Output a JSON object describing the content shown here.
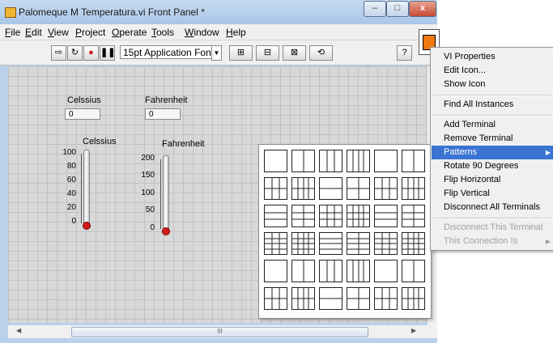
{
  "window": {
    "title": "Palomeque M Temperatura.vi Front Panel *",
    "minimize": "–",
    "maximize": "□",
    "close": "x"
  },
  "menubar": [
    "File",
    "Edit",
    "View",
    "Project",
    "Operate",
    "Tools",
    "Window",
    "Help"
  ],
  "toolbar": {
    "font": "15pt Application Font",
    "help": "?"
  },
  "panel": {
    "celsius_control": {
      "label": "Celssius",
      "value": "0"
    },
    "fahrenheit_control": {
      "label": "Fahrenheit",
      "value": "0"
    },
    "celsius_thermo": {
      "label": "Celssius",
      "ticks": [
        "100",
        "80",
        "60",
        "40",
        "20",
        "0"
      ]
    },
    "fahrenheit_thermo": {
      "label": "Fahrenheit",
      "ticks": [
        "200",
        "150",
        "100",
        "50",
        "0"
      ]
    }
  },
  "hscroll": {
    "grip": "III"
  },
  "context_menu": {
    "items": [
      "VI Properties",
      "Edit Icon...",
      "Show Icon",
      "Find All Instances",
      "Add Terminal",
      "Remove Terminal",
      "Patterns",
      "Rotate 90 Degrees",
      "Flip Horizontal",
      "Flip Vertical",
      "Disconnect All Terminals",
      "Disconnect This Terminal",
      "This Connection Is"
    ],
    "highlighted": "Patterns",
    "highlight_color": "#3a74d3"
  },
  "colors": {
    "thermometer_fluid": "#d11a1a",
    "vi_icon": "#f07a10"
  }
}
